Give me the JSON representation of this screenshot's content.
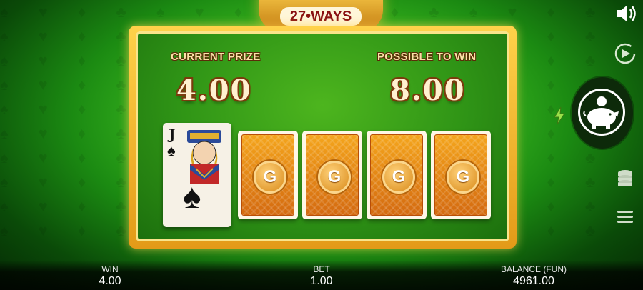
{
  "game": {
    "logo_text": "27•WAYS"
  },
  "gamble": {
    "current_prize_label": "CURRENT PRIZE",
    "current_prize_value": "4.00",
    "possible_label": "POSSIBLE TO WIN",
    "possible_value": "8.00",
    "revealed_card": {
      "rank": "J",
      "suit": "♠"
    },
    "card_back_letter": "G"
  },
  "controls": {
    "sound_icon": "speaker-icon",
    "autoplay_icon": "autoplay-icon",
    "collect_icon": "piggy-bank-icon",
    "turbo_icon": "lightning-icon",
    "bet_icon": "coin-stack-icon",
    "menu_icon": "hamburger-menu-icon"
  },
  "footer": {
    "win_label": "WIN",
    "win_value": "4.00",
    "bet_label": "BET",
    "bet_value": "1.00",
    "balance_label": "BALANCE (FUN)",
    "balance_value": "4961.00"
  },
  "colors": {
    "accent_gold": "#ffd24a",
    "felt_green": "#2f9416",
    "card_orange": "#e8861a"
  }
}
